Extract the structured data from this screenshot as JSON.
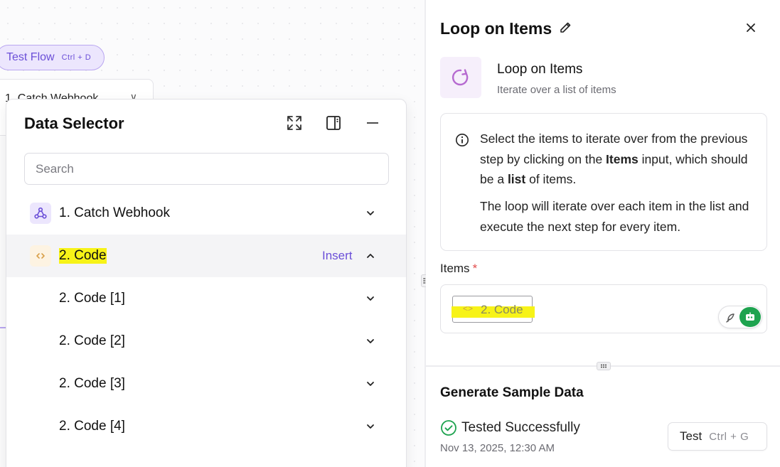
{
  "canvas": {
    "test_flow_label": "Test Flow",
    "test_flow_shortcut": "Ctrl + D",
    "node_label": "1. Catch Webhook"
  },
  "data_selector": {
    "title": "Data Selector",
    "search_placeholder": "Search",
    "rows": [
      {
        "label": "1. Catch Webhook",
        "icon": "webhook-icon"
      },
      {
        "label": "2. Code",
        "icon": "code-icon",
        "action": "Insert",
        "expanded": true,
        "highlighted": true
      },
      {
        "label": "2. Code [1]"
      },
      {
        "label": "2. Code [2]"
      },
      {
        "label": "2. Code [3]"
      },
      {
        "label": "2. Code [4]"
      }
    ]
  },
  "panel": {
    "title": "Loop on Items",
    "piece_name": "Loop on Items",
    "piece_description": "Iterate over a list of items",
    "info_p1_a": "Select the items to iterate over from the previous step by clicking on the ",
    "info_p1_bold1": "Items",
    "info_p1_b": " input, which should be a ",
    "info_p1_bold2": "list",
    "info_p1_c": " of items.",
    "info_p2": "The loop will iterate over each item in the list and execute the next step for every item.",
    "items_label": "Items",
    "items_required": "*",
    "items_value": "2. Code",
    "generate_title": "Generate Sample Data",
    "tested_label": "Tested Successfully",
    "tested_date": "Nov 13, 2025, 12:30 AM",
    "test_button": "Test",
    "test_shortcut": "Ctrl + G"
  },
  "colors": {
    "accent": "#6b4fd8",
    "highlight": "#f7f318",
    "success": "#1ea34f",
    "loop_icon": "#b66ad0"
  }
}
